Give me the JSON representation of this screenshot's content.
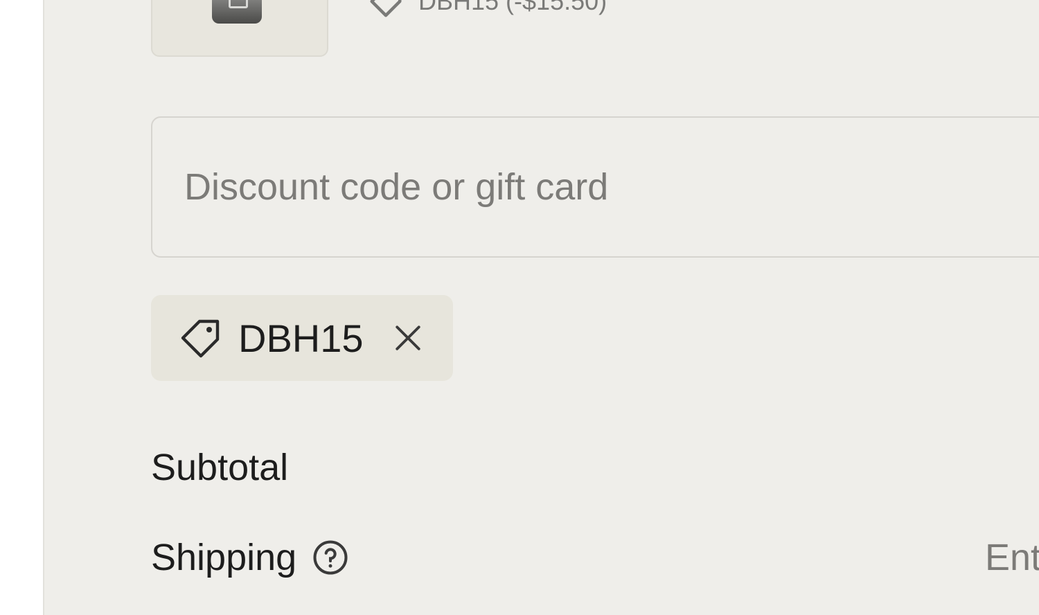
{
  "line_item": {
    "thumbnail_icon": "product-image",
    "discount_icon": "tag-icon",
    "discount_text": "DBH15 (-$15.50)"
  },
  "discount": {
    "placeholder": "Discount code or gift card",
    "applied_code": "DBH15",
    "tag_icon": "tag-icon",
    "remove_icon": "close-icon"
  },
  "totals": {
    "subtotal_label": "Subtotal",
    "shipping_label": "Shipping",
    "shipping_help_icon": "question-circle-icon",
    "shipping_value": "Ent"
  },
  "colors": {
    "panel_bg": "#efeeea",
    "chip_bg": "#e7e5dc",
    "text": "#1d1d1d",
    "muted_text": "#7c7b78"
  }
}
